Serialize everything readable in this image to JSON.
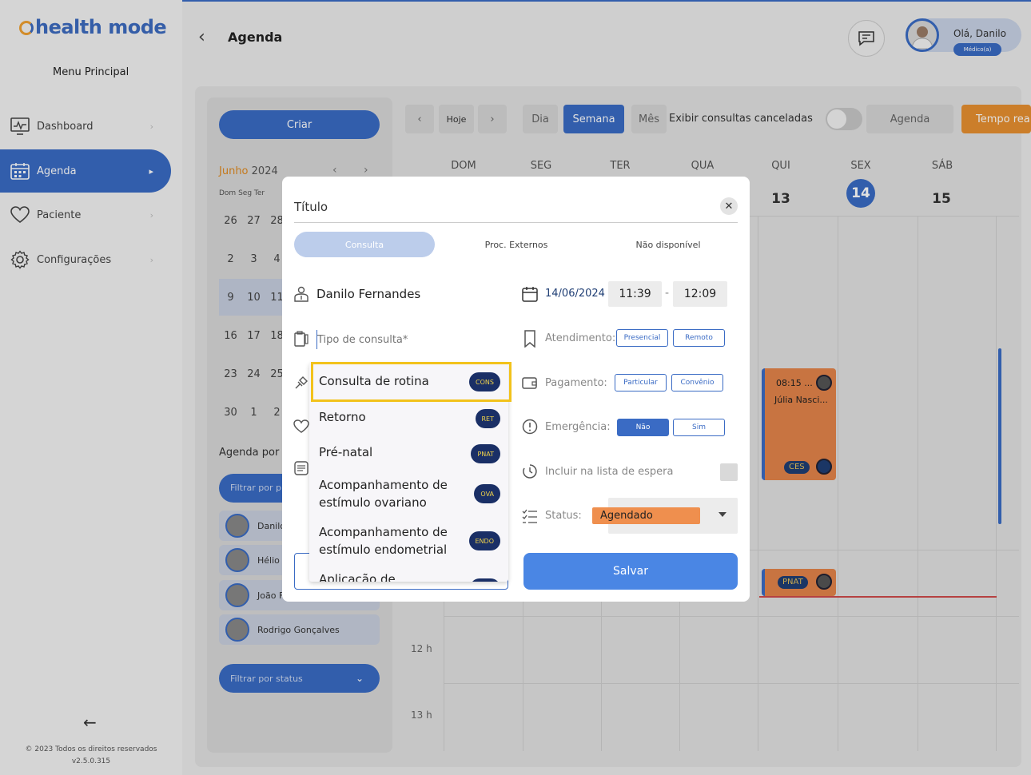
{
  "brand": "health mode",
  "sidebar": {
    "menu_title": "Menu Principal",
    "items": [
      {
        "label": "Dashboard",
        "icon": "dashboard-icon"
      },
      {
        "label": "Agenda",
        "icon": "calendar-icon",
        "active": true
      },
      {
        "label": "Paciente",
        "icon": "heart-icon"
      },
      {
        "label": "Configurações",
        "icon": "gear-icon"
      }
    ],
    "copyright": "© 2023 Todos os direitos reservados",
    "version": "v2.5.0.315"
  },
  "header": {
    "title": "Agenda",
    "user_greeting": "Olá, Danilo",
    "user_role": "Médico(a)"
  },
  "left_panel": {
    "create_label": "Criar",
    "month": "Junho",
    "year": "2024",
    "dow": "Dom Seg  Ter",
    "weeks": [
      [
        "26",
        "27",
        "28"
      ],
      [
        "2",
        "3",
        "4"
      ],
      [
        "9",
        "10",
        "11"
      ],
      [
        "16",
        "17",
        "18"
      ],
      [
        "23",
        "24",
        "25"
      ],
      [
        "30",
        "1",
        "2"
      ]
    ],
    "agenda_por": "Agenda por",
    "filter_prof": "Filtrar por pr",
    "doctors": [
      "Danilo",
      "Hélio S",
      "João F",
      "Rodrigo Gonçalves"
    ],
    "filter_status": "Filtrar por status"
  },
  "toolbar": {
    "today": "Hoje",
    "day": "Dia",
    "week": "Semana",
    "month": "Mês",
    "show_canceled": "Exibir consultas canceladas",
    "agenda": "Agenda",
    "tempo": "Tempo rea"
  },
  "week": {
    "days": [
      "DOM",
      "SEG",
      "TER",
      "QUA",
      "QUI",
      "SEX",
      "SÁB"
    ],
    "numbers": [
      "13",
      "14",
      "15"
    ],
    "hours": [
      "12 h",
      "13 h"
    ]
  },
  "events": {
    "card1_time": "08:15 ...",
    "card1_name": "Júlia Nasci...",
    "card1_badge": "CES",
    "card2_badge": "PNAT"
  },
  "modal": {
    "title": "Título",
    "tabs": [
      "Consulta",
      "Proc. Externos",
      "Não disponível"
    ],
    "doctor": "Danilo Fernandes",
    "tipo_placeholder": "Tipo de consulta*",
    "date": "14/06/2024 ,",
    "start": "11:39",
    "dash": "-",
    "end": "12:09",
    "atendimento_label": "Atendimento:",
    "atendimento_opts": [
      "Presencial",
      "Remoto"
    ],
    "pagamento_label": "Pagamento:",
    "pagamento_opts": [
      "Particular",
      "Convênio"
    ],
    "emergencia_label": "Emergência:",
    "emergencia_opts": [
      "Não",
      "Sim"
    ],
    "espera_label": "Incluir na lista de espera",
    "status_label": "Status:",
    "status_value": "Agendado",
    "save_label": "Salvar"
  },
  "dropdown": {
    "items": [
      {
        "label": "Consulta de rotina",
        "badge": "CONS"
      },
      {
        "label": "Retorno",
        "badge": "RET"
      },
      {
        "label": "Pré-natal",
        "badge": "PNAT"
      },
      {
        "label": "Acompanhamento de estímulo ovariano",
        "badge": "OVA"
      },
      {
        "label": "Acompanhamento de estímulo endometrial",
        "badge": "ENDO"
      },
      {
        "label": "Aplicação de",
        "badge": ""
      }
    ]
  },
  "colors": {
    "primary": "#3a6bc4",
    "accent_orange": "#e89030",
    "highlight": "#f2c21b",
    "badge_bg": "#1a2f66"
  }
}
